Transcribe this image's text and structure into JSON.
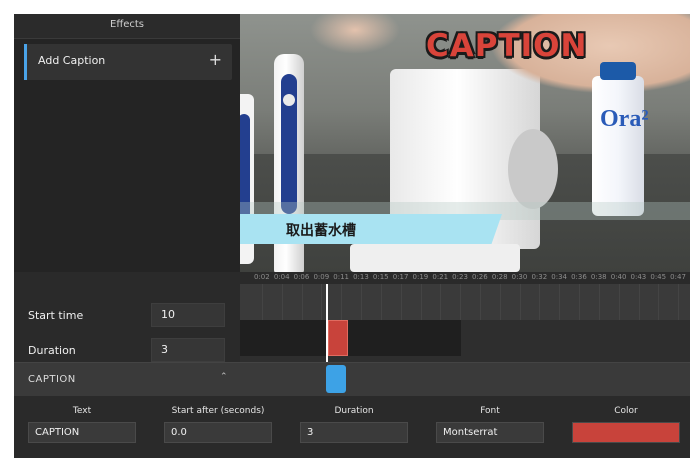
{
  "effects_panel": {
    "title": "Effects",
    "add_caption_label": "Add Caption",
    "add_icon": "+"
  },
  "video": {
    "caption_overlay": "CAPTION",
    "lower_third_text": "取出蓄水槽",
    "toothpaste_brand": "Ora²"
  },
  "timeline": {
    "ruler_ticks": [
      "0:02",
      "0:04",
      "0:06",
      "0:09",
      "0:11",
      "0:13",
      "0:15",
      "0:17",
      "0:19",
      "0:21",
      "0:23",
      "0:26",
      "0:28",
      "0:30",
      "0:32",
      "0:34",
      "0:36",
      "0:38",
      "0:40",
      "0:43",
      "0:45",
      "0:47"
    ]
  },
  "controls": {
    "start_time_label": "Start time",
    "start_time_value": "10",
    "duration_label": "Duration",
    "duration_value": "3"
  },
  "caption_section": {
    "title": "CAPTION",
    "collapse_icon": "chevron-up-icon",
    "fields": {
      "text_label": "Text",
      "text_value": "CAPTION",
      "start_after_label": "Start after (seconds)",
      "start_after_value": "0.0",
      "duration_label": "Duration",
      "duration_value": "3",
      "font_label": "Font",
      "font_value": "Montserrat",
      "color_label": "Color",
      "color_value": "#c8433b"
    }
  }
}
